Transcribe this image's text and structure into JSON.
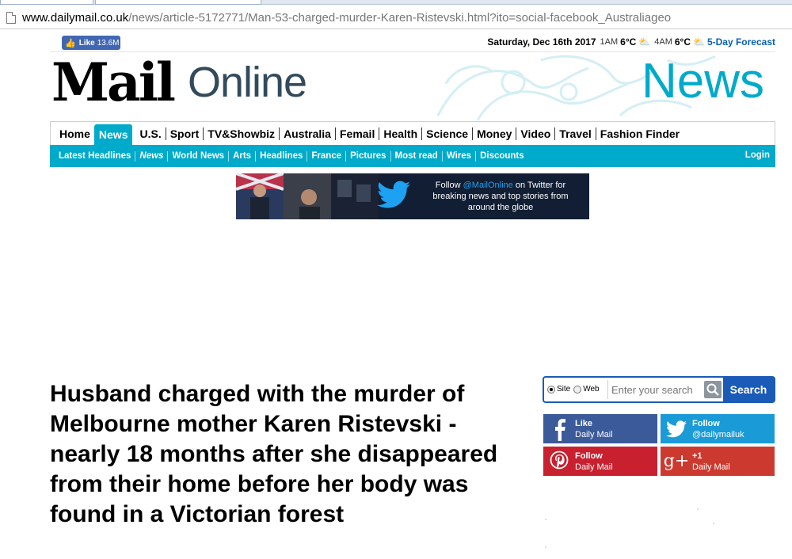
{
  "browser": {
    "url_host": "www.dailymail.co.uk",
    "url_path": "/news/article-5172771/Man-53-charged-murder-Karen-Ristevski.html?ito=social-facebook_Australiageo"
  },
  "topbar": {
    "like_label": "Like",
    "like_count": "13.6M",
    "date": "Saturday, Dec 16th 2017",
    "time1": "1AM",
    "temp1": "6°C",
    "time2": "4AM",
    "temp2": "6°C",
    "forecast_link": "5-Day Forecast"
  },
  "masthead": {
    "logo_mail": "Mail",
    "logo_online": "Online",
    "section": "News"
  },
  "nav_primary": [
    {
      "label": "Home"
    },
    {
      "label": "News",
      "active": true
    },
    {
      "label": "U.S."
    },
    {
      "label": "Sport"
    },
    {
      "label": "TV&Showbiz"
    },
    {
      "label": "Australia"
    },
    {
      "label": "Femail"
    },
    {
      "label": "Health"
    },
    {
      "label": "Science"
    },
    {
      "label": "Money"
    },
    {
      "label": "Video"
    },
    {
      "label": "Travel"
    },
    {
      "label": "Fashion Finder"
    }
  ],
  "nav_secondary": [
    {
      "label": "Latest Headlines"
    },
    {
      "label": "News",
      "active": true
    },
    {
      "label": "World News"
    },
    {
      "label": "Arts"
    },
    {
      "label": "Headlines"
    },
    {
      "label": "France"
    },
    {
      "label": "Pictures"
    },
    {
      "label": "Most read"
    },
    {
      "label": "Wires"
    },
    {
      "label": "Discounts"
    }
  ],
  "login_label": "Login",
  "banner": {
    "line1_prefix": "Follow ",
    "handle": "@MailOnline",
    "line1_suffix": " on Twitter for",
    "line2": "breaking news and top stories from",
    "line3": "around the globe"
  },
  "article": {
    "headline": "Husband charged with the murder of Melbourne mother Karen Ristevski - nearly 18 months after she disappeared from their home before her body was found in a Victorian forest"
  },
  "search": {
    "option_site": "Site",
    "option_web": "Web",
    "placeholder": "Enter your search",
    "button_label": "Search"
  },
  "social": {
    "facebook": {
      "line1": "Like",
      "line2": "Daily Mail"
    },
    "twitter": {
      "line1": "Follow",
      "line2": "@dailymailuk"
    },
    "pinterest": {
      "line1": "Follow",
      "line2": "Daily Mail"
    },
    "googleplus": {
      "icon_text": "g+",
      "line1": "+1",
      "line2": "Daily Mail"
    }
  },
  "colors": {
    "brand_cyan": "#00aaca",
    "search_blue": "#1a5bb8",
    "facebook": "#3b5a9a",
    "twitter": "#1a9ad6",
    "pinterest": "#c8202f",
    "googleplus": "#cc3a2f"
  },
  "icons": [
    "page-icon",
    "facebook-thumb-icon",
    "weather-cloud-sun-icon",
    "lion-crest-icon",
    "twitter-bird-icon",
    "magnifier-icon",
    "facebook-icon",
    "twitter-icon",
    "pinterest-icon",
    "googleplus-icon"
  ]
}
